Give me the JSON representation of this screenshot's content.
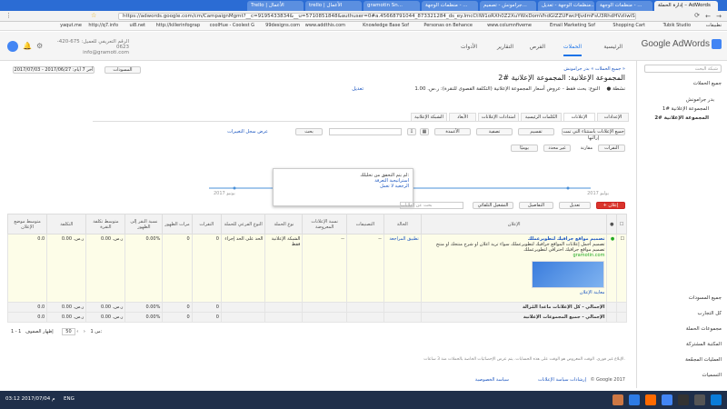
{
  "browser": {
    "tabs": [
      "إدارة الحملة – AdWords",
      "منظمات الوجهة - ...",
      "منظمات الوجهة - تعديل...",
      "جرامونش - تصميم...",
      "منظمات الوجهة - ...",
      "gramotin Sn...",
      "trello | الأعمال",
      "Trello | الأعمال"
    ],
    "url": "https://adwords.google.com/cm/CampaignMgmt?__c=9195433834&__u=5710851848&authuser=0#a.45668791044_873321284_ds_ey.ImcCtlW1oRXh0Z2XuYWxDomVhdGlZZUFwcHJvdmFsU3RhdHVzIiwiSUdiFc",
    "bookmarks": [
      "تطبيقات",
      "Tubik Studio",
      "Shopping Cart",
      "Email Marketing Sof",
      "www.columnfiveme",
      "Personas on Behance",
      "Knowledge Base Sof",
      "www.addthis.com",
      "99designs.com",
      "coolHue - Coolest G",
      "http://killerinfograp",
      "ui8.net",
      "http://q7.info",
      "yaqut.me"
    ]
  },
  "header": {
    "logo": "Google AdWords",
    "nav": [
      "الرئيسية",
      "الحملات",
      "الفرص",
      "التقارير",
      "الأدوات"
    ],
    "account_label": "الرقم التعريفي للعميل: 675-420-0623",
    "account_email": "info@gramoti.com"
  },
  "sidebar": {
    "search_placeholder": "شبكة البحث",
    "all_campaigns": "جميع الحملات",
    "campaign": "بدر جرامونش",
    "adgroups": [
      "المجموعة الإعلانية #1",
      "المجموعة الإعلانية #2"
    ],
    "bottom_items": [
      "جميع المسودات",
      "كل التجارب",
      "مجموعات الحملة",
      "المكتبة المشتركة",
      "العمليات المجمّعة",
      "التسميات"
    ]
  },
  "main": {
    "breadcrumb": "جميع الحملات » بدر جرامونش »",
    "title": "المجموعة الإعلانية: المجموعة الإعلانية #2",
    "status_label": "نشطة",
    "type_line": "النوع: بحث فقط - عروض أسعار المجموعة الإعلانية (التكلفة القصوى للنقرة): ر.س. 1.00",
    "edit": "تعديل",
    "date_range": "آخر 7 أيام: 2017/06/27 - 2017/07/03",
    "drafts": "المسودات",
    "tabs": [
      "الإعدادات",
      "الإعلانات",
      "الكلمات الرئيسية",
      "امتدادات الإعلانات",
      "الأبعاد",
      "الشبكة الإعلانية"
    ],
    "filter_all": "جميع الإعلانات باستثناء التي تمت إزالتها",
    "segment": "تقسيم",
    "filter": "تصفية",
    "columns": "الأعمدة",
    "search_btn": "بحث",
    "view_history": "عرض سجل التغييرات",
    "compare": "مقارنة",
    "clicks_metric": "النقرات",
    "none_metric": "غير محدد",
    "weekly": "يوميًا",
    "tooltip_title": "لم يتم التحقق من تحليلك:",
    "tooltip_items": [
      "استراتيجية التعرفة",
      "الرجعية لا تعمل"
    ],
    "chart_left": "2017 يونيو",
    "chart_right": "2017 يوليو",
    "new_ad": "+ إعلان",
    "edit_btn": "تعديل",
    "details_btn": "التفاصيل",
    "automate": "التشغيل التلقائي",
    "search_ads": "بحث عن إعلانات"
  },
  "table": {
    "headers": [
      "",
      "",
      "الإعلان",
      "الحالة",
      "التصنيفات",
      "نسبة الإعلانات المعروضة",
      "نوع الحملة",
      "النوع الفرعي للحملة",
      "النقرات",
      "مرات الظهور",
      "نسبة النقر إلى الظهور",
      "متوسط تكلفة النقرة",
      "التكلفة",
      "متوسط موضع الإعلان"
    ],
    "ad": {
      "headline": "تصميم مواقع جرافيك لتطويرعملك",
      "line1": "تصميم أجمل إعلانات المواقع جرافيك لتطويرعملك سواء تريد اعلان او شرح منتجك او منتج",
      "line2": "تصميم مواقع جرافيك احترافي لتطويرعملك",
      "url": "gramotin.com",
      "preview": "معاينة الإعلان",
      "status": "تطبيق المراجعة",
      "labels": "--",
      "share": "--",
      "camp_type": "الشبكة الإعلانية فقط",
      "subtype": "الحد على الحد إجراء",
      "clicks": "0",
      "impr": "0",
      "ctr": "0.00%",
      "cpc": "ر.س. 0.00",
      "cost": "ر.س. 0.00",
      "pos": "0.0"
    },
    "total1": {
      "label": "الإجمالي - كل الإعلانات ماعدا المُزالة",
      "clicks": "0",
      "impr": "0",
      "ctr": "0.00%",
      "cpc": "ر.س. 0.00",
      "cost": "ر.س. 0.00",
      "pos": "0.0"
    },
    "total2": {
      "label": "الإجمالي - جميع المجموعات الإعلانية",
      "clicks": "0",
      "impr": "0",
      "ctr": "0.00%",
      "cpc": "ر.س. 0.00",
      "cost": "ر.س. 0.00",
      "pos": "0.0"
    },
    "pager_rows": "إظهار الصفوف:",
    "pager_size": "50",
    "pager_range": "1 - 1 من 1"
  },
  "footer": {
    "disclaimer": "الإبلاغ غير فوري. الوقت المعروض هو الوقت على هذه الحسابات. يتم عرض الإحصائيات الخاصة بالحملات منذ 3 ساعات.",
    "copyright": "© Google 2017",
    "links": [
      "إرشادات سياسة الإعلانات",
      "سياسة الخصوصية"
    ]
  },
  "taskbar": {
    "time": "03:12 م",
    "date": "2017/07/04",
    "lang": "ENG"
  }
}
